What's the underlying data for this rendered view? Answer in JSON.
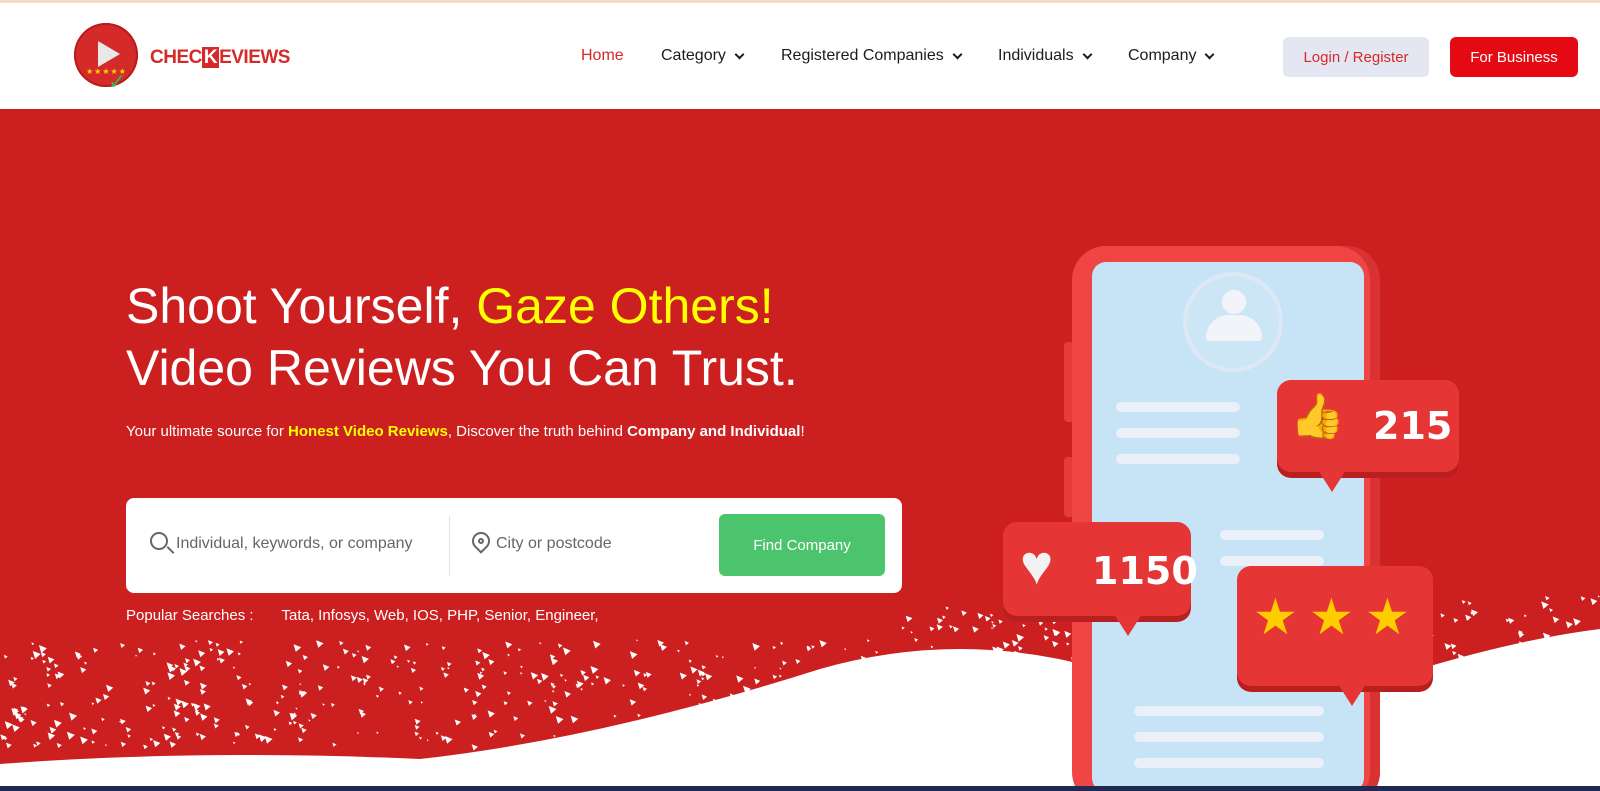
{
  "logo": {
    "text_a": "CHEC",
    "text_b": "K",
    "text_c": "EVIEWS",
    "stars": "★★★★★"
  },
  "nav": {
    "home": "Home",
    "category": "Category",
    "registered_companies": "Registered Companies",
    "individuals": "Individuals",
    "company": "Company"
  },
  "header": {
    "login_label": "Login / Register",
    "business_label": "For Business"
  },
  "hero": {
    "headline_a": "Shoot Yourself, ",
    "headline_highlight": "Gaze Others!",
    "headline_b": "Video Reviews You Can Trust.",
    "sub_a": "Your ultimate source for ",
    "sub_highlight": "Honest Video Reviews",
    "sub_b": ", Discover the truth behind ",
    "sub_bold": "Company and Individual",
    "sub_c": "!"
  },
  "search": {
    "keyword_placeholder": "Individual, keywords, or company",
    "city_placeholder": "City or postcode",
    "button_label": "Find Company"
  },
  "popular": {
    "label": "Popular Searches :",
    "terms": "Tata, Infosys, Web, IOS, PHP, Senior, Engineer,"
  },
  "illustration": {
    "likes_count": "1150",
    "thumbs_count": "215",
    "icons": [
      "heart-icon",
      "thumbs-up-icon",
      "star-icon"
    ]
  },
  "colors": {
    "brand_red": "#cc1f1f",
    "button_red": "#e50914",
    "highlight_yellow": "#ffff00",
    "find_green": "#4cc46e"
  }
}
